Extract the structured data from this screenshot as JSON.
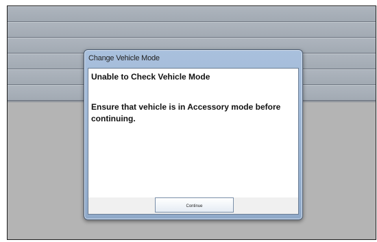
{
  "dialog": {
    "title": "Change Vehicle Mode",
    "heading": "Unable to Check Vehicle Mode",
    "message": "Ensure that vehicle is in Accessory mode before continuing.",
    "continue_label": "Continue"
  }
}
